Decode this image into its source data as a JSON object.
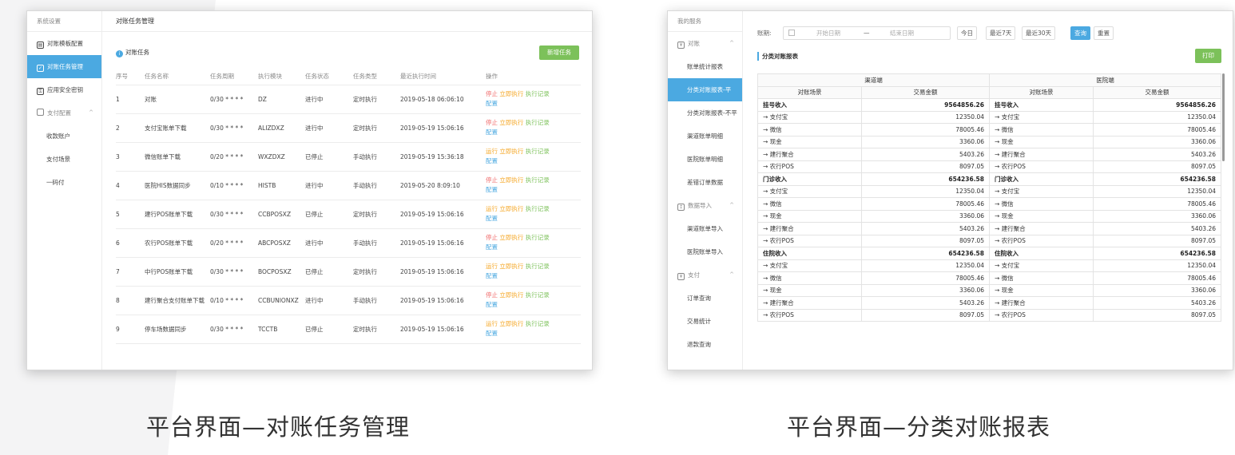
{
  "captions": {
    "left": "平台界面—对账任务管理",
    "right": "平台界面—分类对账报表"
  },
  "screen1": {
    "sidebar": {
      "header": "系统设置",
      "items": [
        {
          "label": "对账模板配置"
        },
        {
          "label": "对账任务管理"
        },
        {
          "label": "应用安全密钥"
        },
        {
          "label": "支付配置"
        },
        {
          "label": "收款账户"
        },
        {
          "label": "支付场景"
        },
        {
          "label": "一码付"
        }
      ]
    },
    "topbar_title": "对账任务管理",
    "section_title": "对账任务",
    "add_button": "新增任务",
    "columns": [
      "序号",
      "任务名称",
      "任务周期",
      "执行模块",
      "任务状态",
      "任务类型",
      "最近执行时间",
      "操作"
    ],
    "rows": [
      {
        "no": "1",
        "name": "对账",
        "cycle": "0/30 * * * *",
        "module": "DZ",
        "status": "进行中",
        "type": "定时执行",
        "time": "2019-05-18 06:06:10",
        "op1": "停止"
      },
      {
        "no": "2",
        "name": "支付宝账单下载",
        "cycle": "0/30 * * * *",
        "module": "ALIZDXZ",
        "status": "进行中",
        "type": "定时执行",
        "time": "2019-05-19 15:06:16",
        "op1": "停止"
      },
      {
        "no": "3",
        "name": "微信账单下载",
        "cycle": "0/20 * * * *",
        "module": "WXZDXZ",
        "status": "已停止",
        "type": "手动执行",
        "time": "2019-05-19 15:36:18",
        "op1": "运行"
      },
      {
        "no": "4",
        "name": "医院HIS数据同步",
        "cycle": "0/10 * * * *",
        "module": "HISTB",
        "status": "进行中",
        "type": "手动执行",
        "time": "2019-05-20 8:09:10",
        "op1": "停止"
      },
      {
        "no": "5",
        "name": "建行POS账单下载",
        "cycle": "0/30 * * * *",
        "module": "CCBPOSXZ",
        "status": "已停止",
        "type": "定时执行",
        "time": "2019-05-19 15:06:16",
        "op1": "运行"
      },
      {
        "no": "6",
        "name": "农行POS账单下载",
        "cycle": "0/20 * * * *",
        "module": "ABCPOSXZ",
        "status": "进行中",
        "type": "手动执行",
        "time": "2019-05-19 15:06:16",
        "op1": "停止"
      },
      {
        "no": "7",
        "name": "中行POS账单下载",
        "cycle": "0/30 * * * *",
        "module": "BOCPOSXZ",
        "status": "已停止",
        "type": "定时执行",
        "time": "2019-05-19 15:06:16",
        "op1": "运行"
      },
      {
        "no": "8",
        "name": "建行聚合支付账单下载",
        "cycle": "0/10 * * * *",
        "module": "CCBUNIONXZ",
        "status": "进行中",
        "type": "手动执行",
        "time": "2019-05-19 15:06:16",
        "op1": "停止"
      },
      {
        "no": "9",
        "name": "停车场数据同步",
        "cycle": "0/30 * * * *",
        "module": "TCCTB",
        "status": "已停止",
        "type": "定时执行",
        "time": "2019-05-19 15:06:16",
        "op1": "运行"
      }
    ],
    "op_run_now": "立即执行",
    "op_log": "执行记录",
    "op_config": "配置"
  },
  "screen2": {
    "sidebar": {
      "header": "我的服务",
      "items": [
        {
          "label": "对账"
        },
        {
          "label": "账单统计报表"
        },
        {
          "label": "分类对账报表-平"
        },
        {
          "label": "分类对账报表-不平"
        },
        {
          "label": "渠道账单明细"
        },
        {
          "label": "医院账单明细"
        },
        {
          "label": "差错订单数据"
        },
        {
          "label": "数据导入"
        },
        {
          "label": "渠道账单导入"
        },
        {
          "label": "医院账单导入"
        },
        {
          "label": "支付"
        },
        {
          "label": "订单查询"
        },
        {
          "label": "交易统计"
        },
        {
          "label": "退款查询"
        }
      ]
    },
    "filter": {
      "period_label": "账期:",
      "start_placeholder": "开始日期",
      "separator": "—",
      "end_placeholder": "结束日期",
      "today": "今日",
      "last7": "最近7天",
      "last30": "最近30天",
      "query": "查询",
      "reset": "重置"
    },
    "report_title": "分类对账报表",
    "print_button": "打印",
    "group_channel": "渠道端",
    "group_hospital": "医院端",
    "col_scene": "对账场景",
    "col_amount": "交易金额",
    "rows": [
      {
        "bold": true,
        "l_scene": "挂号收入",
        "l_amt": "9564856.26",
        "r_scene": "挂号收入",
        "r_amt": "9564856.26"
      },
      {
        "bold": false,
        "l_scene": "→ 支付宝",
        "l_amt": "12350.04",
        "r_scene": "→ 支付宝",
        "r_amt": "12350.04"
      },
      {
        "bold": false,
        "l_scene": "→ 微信",
        "l_amt": "78005.46",
        "r_scene": "→ 微信",
        "r_amt": "78005.46"
      },
      {
        "bold": false,
        "l_scene": "→ 现金",
        "l_amt": "3360.06",
        "r_scene": "→ 现金",
        "r_amt": "3360.06"
      },
      {
        "bold": false,
        "l_scene": "→ 建行聚合",
        "l_amt": "5403.26",
        "r_scene": "→ 建行聚合",
        "r_amt": "5403.26"
      },
      {
        "bold": false,
        "l_scene": "→ 农行POS",
        "l_amt": "8097.05",
        "r_scene": "→ 农行POS",
        "r_amt": "8097.05"
      },
      {
        "bold": true,
        "l_scene": "门诊收入",
        "l_amt": "654236.58",
        "r_scene": "门诊收入",
        "r_amt": "654236.58"
      },
      {
        "bold": false,
        "l_scene": "→ 支付宝",
        "l_amt": "12350.04",
        "r_scene": "→ 支付宝",
        "r_amt": "12350.04"
      },
      {
        "bold": false,
        "l_scene": "→ 微信",
        "l_amt": "78005.46",
        "r_scene": "→ 微信",
        "r_amt": "78005.46"
      },
      {
        "bold": false,
        "l_scene": "→ 现金",
        "l_amt": "3360.06",
        "r_scene": "→ 现金",
        "r_amt": "3360.06"
      },
      {
        "bold": false,
        "l_scene": "→ 建行聚合",
        "l_amt": "5403.26",
        "r_scene": "→ 建行聚合",
        "r_amt": "5403.26"
      },
      {
        "bold": false,
        "l_scene": "→ 农行POS",
        "l_amt": "8097.05",
        "r_scene": "→ 农行POS",
        "r_amt": "8097.05"
      },
      {
        "bold": true,
        "l_scene": "住院收入",
        "l_amt": "654236.58",
        "r_scene": "住院收入",
        "r_amt": "654236.58"
      },
      {
        "bold": false,
        "l_scene": "→ 支付宝",
        "l_amt": "12350.04",
        "r_scene": "→ 支付宝",
        "r_amt": "12350.04"
      },
      {
        "bold": false,
        "l_scene": "→ 微信",
        "l_amt": "78005.46",
        "r_scene": "→ 微信",
        "r_amt": "78005.46"
      },
      {
        "bold": false,
        "l_scene": "→ 现金",
        "l_amt": "3360.06",
        "r_scene": "→ 现金",
        "r_amt": "3360.06"
      },
      {
        "bold": false,
        "l_scene": "→ 建行聚合",
        "l_amt": "5403.26",
        "r_scene": "→ 建行聚合",
        "r_amt": "5403.26"
      },
      {
        "bold": false,
        "l_scene": "→ 农行POS",
        "l_amt": "8097.05",
        "r_scene": "→ 农行POS",
        "r_amt": "8097.05"
      }
    ]
  }
}
